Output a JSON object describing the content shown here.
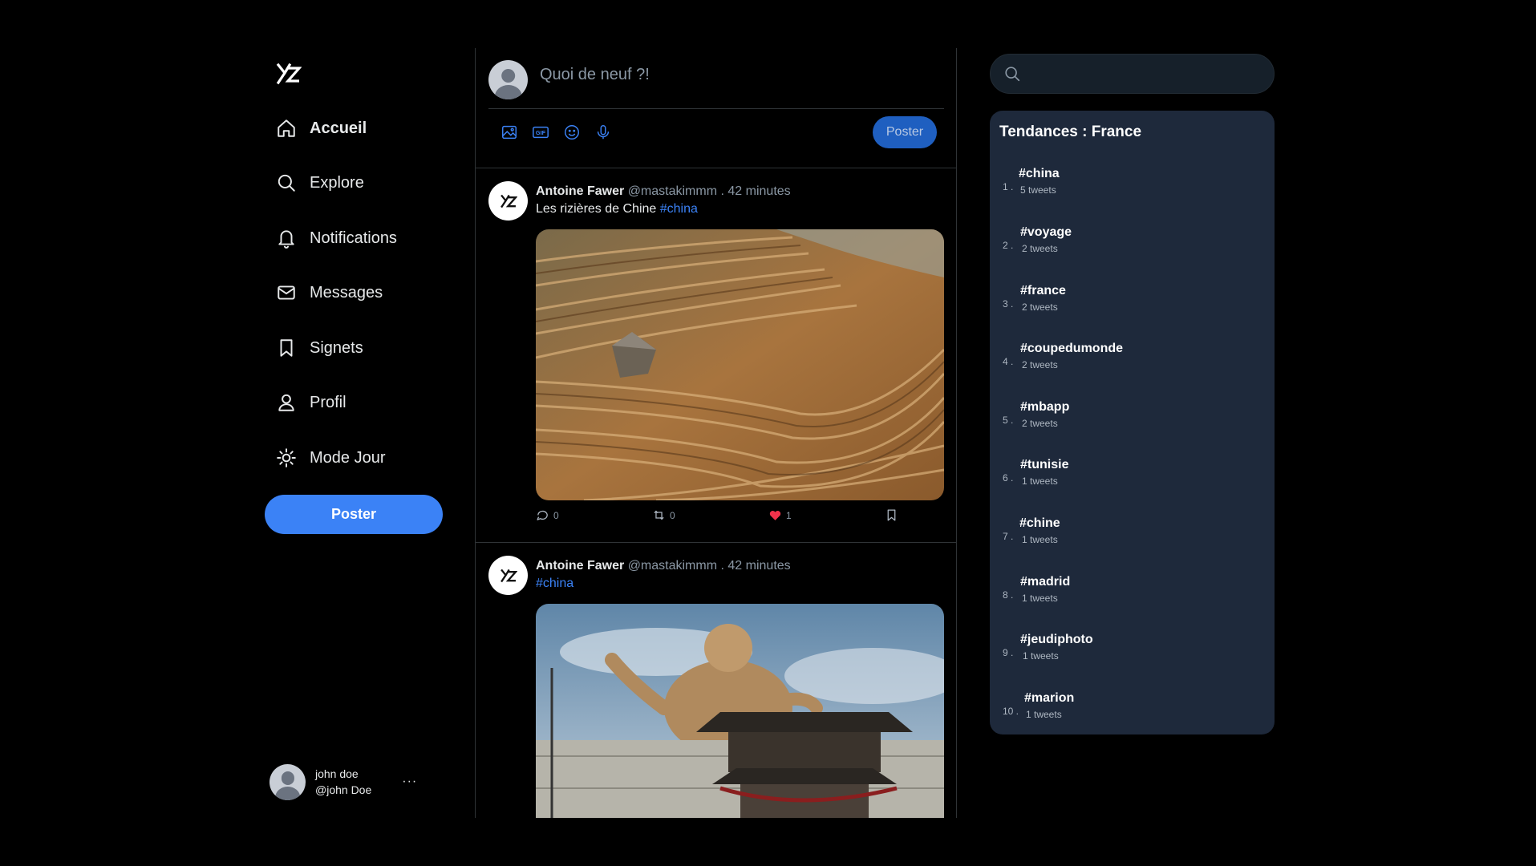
{
  "nav": {
    "items": [
      {
        "label": "Accueil",
        "icon": "home-icon"
      },
      {
        "label": "Explore",
        "icon": "search-icon"
      },
      {
        "label": "Notifications",
        "icon": "bell-icon"
      },
      {
        "label": "Messages",
        "icon": "mail-icon"
      },
      {
        "label": "Signets",
        "icon": "bookmark-icon"
      },
      {
        "label": "Profil",
        "icon": "user-icon"
      },
      {
        "label": "Mode Jour",
        "icon": "sun-icon"
      }
    ],
    "post_label": "Poster"
  },
  "user": {
    "name": "john doe",
    "handle": "@john Doe",
    "more": "···"
  },
  "composer": {
    "placeholder": "Quoi de neuf ?!",
    "post_label": "Poster"
  },
  "tweets": [
    {
      "name": "Antoine Fawer",
      "handle": "@mastakimmm",
      "time": ". 42 minutes",
      "text": "Les rizières de Chine ",
      "hashtag": "#china",
      "image": "rice-terraces-photo",
      "comments": "0",
      "retweets": "0",
      "likes": "1"
    },
    {
      "name": "Antoine Fawer",
      "handle": "@mastakimmm",
      "time": ". 42 minutes",
      "text": "",
      "hashtag": "#china",
      "image": "buddha-statue-photo"
    }
  ],
  "trends": {
    "title": "Tendances : France",
    "items": [
      {
        "rank": "1 .",
        "tag": "#china",
        "count": "5 tweets"
      },
      {
        "rank": "2 .",
        "tag": "#voyage",
        "count": "2 tweets"
      },
      {
        "rank": "3 .",
        "tag": "#france",
        "count": "2 tweets"
      },
      {
        "rank": "4 .",
        "tag": "#coupedumonde",
        "count": "2 tweets"
      },
      {
        "rank": "5 .",
        "tag": "#mbapp",
        "count": "2 tweets"
      },
      {
        "rank": "6 .",
        "tag": "#tunisie",
        "count": "1 tweets"
      },
      {
        "rank": "7 .",
        "tag": "#chine",
        "count": "1 tweets"
      },
      {
        "rank": "8 .",
        "tag": "#madrid",
        "count": "1 tweets"
      },
      {
        "rank": "9 .",
        "tag": "#jeudiphoto",
        "count": "1 tweets"
      },
      {
        "rank": "10 .",
        "tag": "#marion",
        "count": "1 tweets"
      }
    ]
  },
  "colors": {
    "accent": "#3b82f6",
    "like": "#f0324b",
    "trend_bg": "#1e293b"
  }
}
